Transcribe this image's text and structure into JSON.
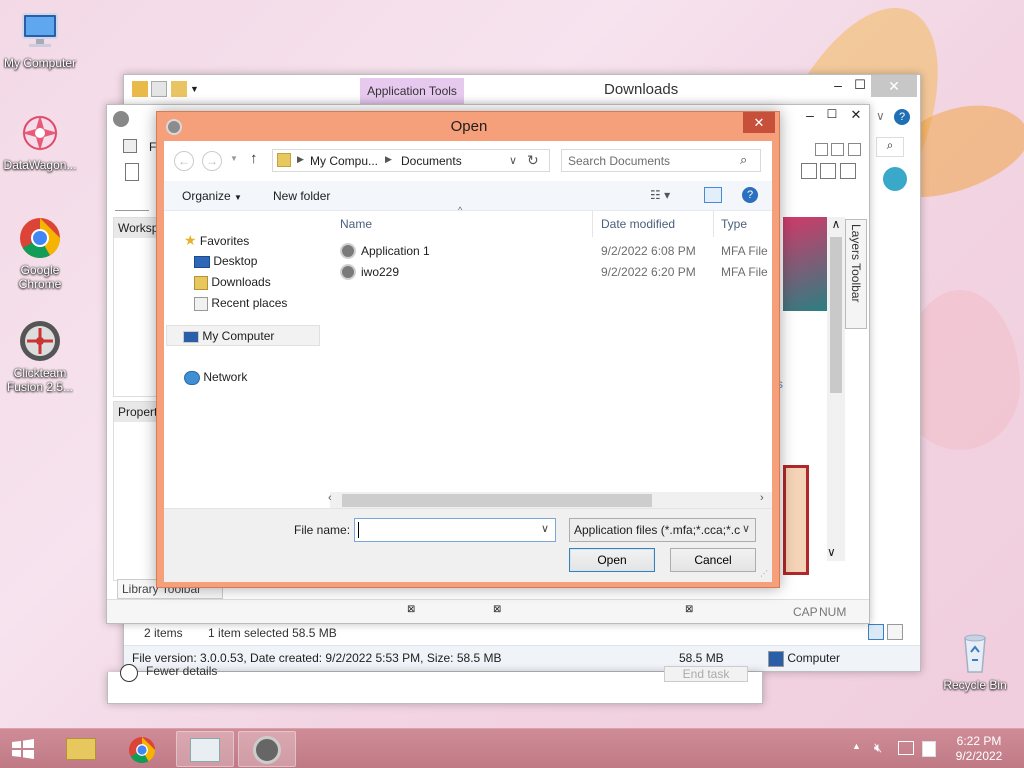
{
  "desktop": {
    "icons": [
      {
        "label": "My Computer"
      },
      {
        "label": "DataWagon..."
      },
      {
        "label": "Google Chrome"
      },
      {
        "label": "Clickteam Fusion 2.5..."
      },
      {
        "label": "Recycle Bin"
      }
    ]
  },
  "explorer_window": {
    "ribbon_context": "Application Tools",
    "title": "Downloads",
    "status_items": "2 items",
    "status_selected": "1 item selected  58.5 MB",
    "details": "File version: 3.0.0.53, Date created: 9/2/2022 5:53 PM, Size: 58.5 MB",
    "details_size": "58.5 MB",
    "details_location": "Computer",
    "power_details": "Fewer details",
    "end_task": "End task"
  },
  "fusion_window": {
    "menu_first": "Fi",
    "workspace": "Workspa",
    "properties": "Propert",
    "layers_toolbar": "Layers Toolbar",
    "library_toolbar": "Library Toolbar",
    "status_cap": "CAP",
    "status_num": "NUM"
  },
  "dialog": {
    "title": "Open",
    "breadcrumb": [
      "My Compu...",
      "Documents"
    ],
    "search_placeholder": "Search Documents",
    "organize_label": "Organize",
    "new_folder_label": "New folder",
    "nav": {
      "favorites": "Favorites",
      "desktop": "Desktop",
      "downloads": "Downloads",
      "recent": "Recent places",
      "my_computer": "My Computer",
      "network": "Network"
    },
    "columns": {
      "name": "Name",
      "date": "Date modified",
      "type": "Type"
    },
    "files": [
      {
        "name": "Application 1",
        "date": "9/2/2022 6:08 PM",
        "type": "MFA File"
      },
      {
        "name": "iwo229",
        "date": "9/2/2022 6:20 PM",
        "type": "MFA File"
      }
    ],
    "file_name_label": "File name:",
    "file_name_value": "",
    "file_type": "Application files (*.mfa;*.cca;*.c",
    "open_button": "Open",
    "cancel_button": "Cancel"
  },
  "taskbar": {
    "time": "6:22 PM",
    "date": "9/2/2022"
  }
}
